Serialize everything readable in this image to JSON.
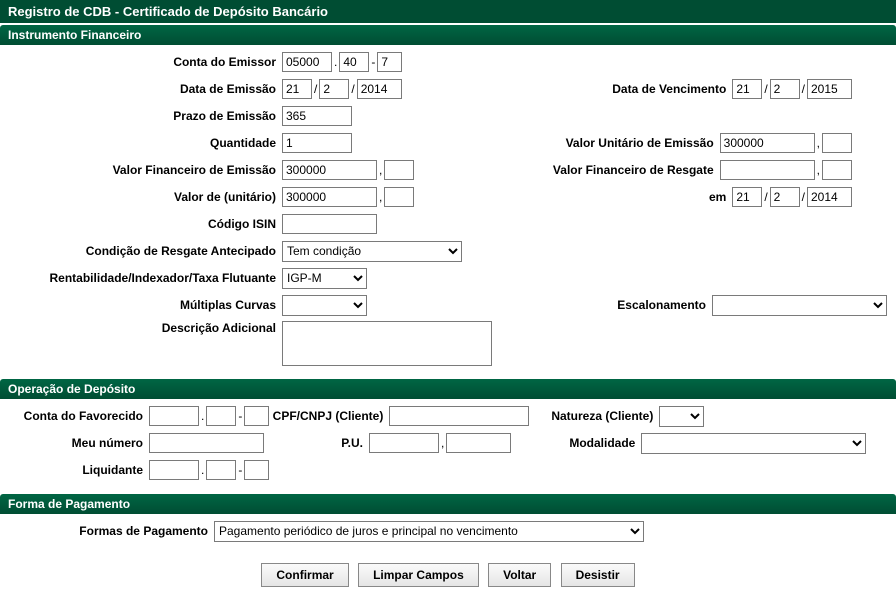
{
  "header": {
    "title": "Registro de CDB - Certificado de Depósito Bancário"
  },
  "sections": {
    "instrumento": "Instrumento Financeiro",
    "deposito": "Operação de Depósito",
    "pagamento": "Forma de Pagamento"
  },
  "labels": {
    "conta_emissor": "Conta do Emissor",
    "data_emissao": "Data de Emissão",
    "data_vencimento": "Data de Vencimento",
    "prazo_emissao": "Prazo de Emissão",
    "quantidade": "Quantidade",
    "valor_unitario_emissao": "Valor Unitário de Emissão",
    "valor_financeiro_emissao": "Valor Financeiro de Emissão",
    "valor_financeiro_resgate": "Valor Financeiro de Resgate",
    "valor_de_unitario": "Valor de (unitário)",
    "em": "em",
    "codigo_isin": "Código ISIN",
    "condicao_resgate": "Condição de Resgate Antecipado",
    "rentabilidade": "Rentabilidade/Indexador/Taxa Flutuante",
    "multiplas_curvas": "Múltiplas Curvas",
    "escalonamento": "Escalonamento",
    "descricao_adicional": "Descrição Adicional",
    "conta_favorecido": "Conta do Favorecido",
    "cpf_cnpj": "CPF/CNPJ (Cliente)",
    "natureza": "Natureza (Cliente)",
    "meu_numero": "Meu número",
    "pu": "P.U.",
    "modalidade": "Modalidade",
    "liquidante": "Liquidante",
    "formas_pagamento": "Formas de Pagamento"
  },
  "values": {
    "conta_emissor": {
      "a": "05000",
      "b": "40",
      "c": "7"
    },
    "data_emissao": {
      "d": "21",
      "m": "2",
      "y": "2014"
    },
    "data_vencimento": {
      "d": "21",
      "m": "2",
      "y": "2015"
    },
    "prazo_emissao": "365",
    "quantidade": "1",
    "valor_unitario_emissao": {
      "int": "300000",
      "dec": ""
    },
    "valor_financeiro_emissao": {
      "int": "300000",
      "dec": ""
    },
    "valor_financeiro_resgate": {
      "int": "",
      "dec": ""
    },
    "valor_de_unitario": {
      "int": "300000",
      "dec": ""
    },
    "em": {
      "d": "21",
      "m": "2",
      "y": "2014"
    },
    "codigo_isin": "",
    "condicao_resgate": "Tem condição",
    "rentabilidade": "IGP-M",
    "multiplas_curvas": "",
    "escalonamento": "",
    "descricao_adicional": "",
    "conta_favorecido": {
      "a": "",
      "b": "",
      "c": ""
    },
    "cpf_cnpj": "",
    "natureza": "",
    "meu_numero": "",
    "pu": {
      "int": "",
      "dec": ""
    },
    "modalidade": "",
    "liquidante": {
      "a": "",
      "b": "",
      "c": ""
    },
    "formas_pagamento": "Pagamento periódico de juros e principal no vencimento"
  },
  "buttons": {
    "confirmar": "Confirmar",
    "limpar": "Limpar Campos",
    "voltar": "Voltar",
    "desistir": "Desistir"
  },
  "sep": {
    "dot": ".",
    "dash": "-",
    "slash": "/",
    "comma": ","
  }
}
